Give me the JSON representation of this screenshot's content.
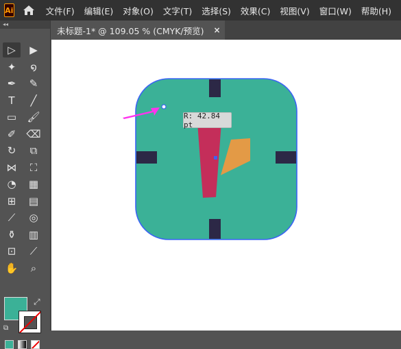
{
  "app": {
    "logo_text": "Ai",
    "home_icon": "home-icon"
  },
  "menu": [
    "文件(F)",
    "编辑(E)",
    "对象(O)",
    "文字(T)",
    "选择(S)",
    "效果(C)",
    "视图(V)",
    "窗口(W)",
    "帮助(H)"
  ],
  "document_tab": {
    "title": "未标题-1* @ 109.05 % (CMYK/预览)",
    "close_glyph": "×"
  },
  "toolbar": {
    "collapse_glyph": "◂◂",
    "tools": [
      {
        "name": "selection-tool",
        "icon": "selection-arrow-icon",
        "glyph": "▷",
        "active": true
      },
      {
        "name": "direct-selection-tool",
        "icon": "direct-selection-icon",
        "glyph": "▶",
        "active": false
      },
      {
        "name": "magic-wand-tool",
        "icon": "magic-wand-icon",
        "glyph": "✦",
        "active": false
      },
      {
        "name": "lasso-tool",
        "icon": "lasso-icon",
        "glyph": "໑",
        "active": false
      },
      {
        "name": "pen-tool",
        "icon": "pen-icon",
        "glyph": "✒",
        "active": false
      },
      {
        "name": "curvature-tool",
        "icon": "curvature-icon",
        "glyph": "✎",
        "active": false
      },
      {
        "name": "type-tool",
        "icon": "type-icon",
        "glyph": "T",
        "active": false
      },
      {
        "name": "line-tool",
        "icon": "line-segment-icon",
        "glyph": "╱",
        "active": false
      },
      {
        "name": "rectangle-tool",
        "icon": "rectangle-icon",
        "glyph": "▭",
        "active": false
      },
      {
        "name": "paintbrush-tool",
        "icon": "paintbrush-icon",
        "glyph": "🖌",
        "active": false
      },
      {
        "name": "shaper-tool",
        "icon": "shaper-icon",
        "glyph": "✐",
        "active": false
      },
      {
        "name": "eraser-tool",
        "icon": "eraser-icon",
        "glyph": "⌫",
        "active": false
      },
      {
        "name": "rotate-tool",
        "icon": "rotate-icon",
        "glyph": "↻",
        "active": false
      },
      {
        "name": "scale-tool",
        "icon": "scale-icon",
        "glyph": "⧉",
        "active": false
      },
      {
        "name": "width-tool",
        "icon": "width-icon",
        "glyph": "⋈",
        "active": false
      },
      {
        "name": "free-transform-tool",
        "icon": "free-transform-icon",
        "glyph": "⛶",
        "active": false
      },
      {
        "name": "shape-builder-tool",
        "icon": "shape-builder-icon",
        "glyph": "◔",
        "active": false
      },
      {
        "name": "perspective-grid-tool",
        "icon": "perspective-grid-icon",
        "glyph": "▦",
        "active": false
      },
      {
        "name": "mesh-tool",
        "icon": "mesh-icon",
        "glyph": "⊞",
        "active": false
      },
      {
        "name": "gradient-tool",
        "icon": "gradient-icon",
        "glyph": "▤",
        "active": false
      },
      {
        "name": "eyedropper-tool",
        "icon": "eyedropper-icon",
        "glyph": "⟋",
        "active": false
      },
      {
        "name": "blend-tool",
        "icon": "blend-icon",
        "glyph": "◎",
        "active": false
      },
      {
        "name": "symbol-sprayer-tool",
        "icon": "symbol-sprayer-icon",
        "glyph": "⚱",
        "active": false
      },
      {
        "name": "column-graph-tool",
        "icon": "column-graph-icon",
        "glyph": "▥",
        "active": false
      },
      {
        "name": "artboard-tool",
        "icon": "artboard-icon",
        "glyph": "⊡",
        "active": false
      },
      {
        "name": "slice-tool",
        "icon": "slice-icon",
        "glyph": "⟋",
        "active": false
      },
      {
        "name": "hand-tool",
        "icon": "hand-icon",
        "glyph": "✋",
        "active": false
      },
      {
        "name": "zoom-tool",
        "icon": "zoom-icon",
        "glyph": "⌕",
        "active": false
      }
    ],
    "fill_color": "#3bb197",
    "stroke_color": "none",
    "swap_glyph": "⤢",
    "default_glyph": "⧉"
  },
  "artwork": {
    "clock_face_color": "#3bb197",
    "clock_outline_color": "#3b63f5",
    "tick_color": "#2c2846",
    "hour_hand_color": "#c42e5a",
    "minute_hand_color": "#e39a46",
    "pointer_arrow_color": "#ff33ee"
  },
  "tooltip": {
    "text": "R: 42.84 pt"
  },
  "colors": {
    "menubar": "#323232",
    "panel": "#535353",
    "tabbar": "#424242",
    "canvas": "#ffffff"
  }
}
